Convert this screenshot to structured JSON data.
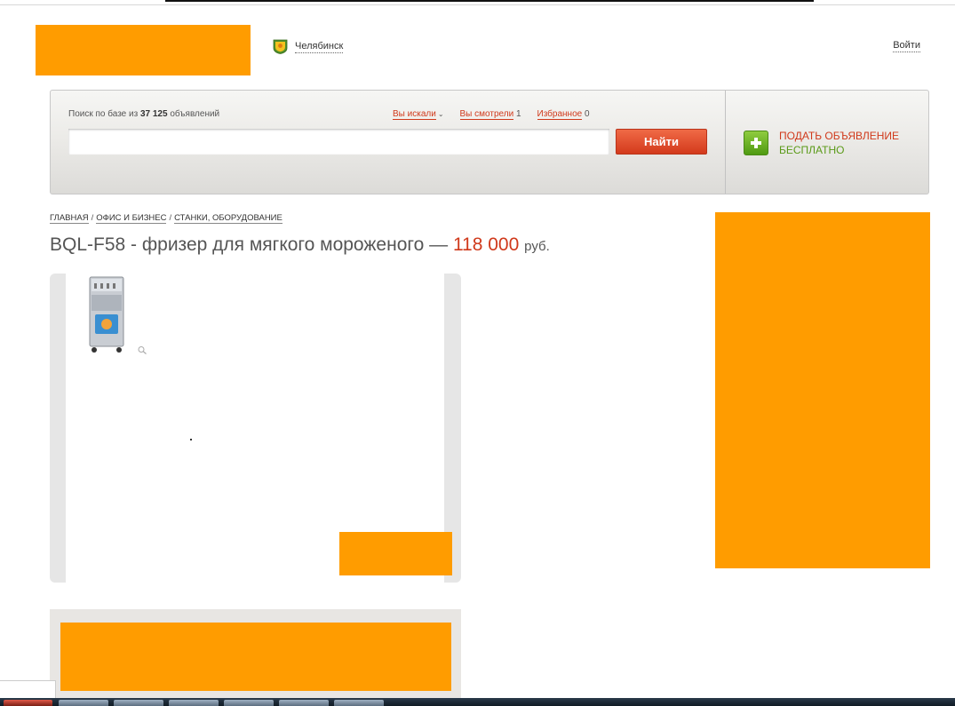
{
  "header": {
    "city": "Челябинск",
    "login": "Войти"
  },
  "search": {
    "caption_prefix": "Поиск по базе из",
    "caption_count": "37 125",
    "caption_suffix": "объявлений",
    "tabs": [
      {
        "label": "Вы искали",
        "count": ""
      },
      {
        "label": "Вы смотрели",
        "count": "1"
      },
      {
        "label": "Избранное",
        "count": "0"
      }
    ],
    "input_value": "",
    "button_label": "Найти"
  },
  "post_ad": {
    "line1": "ПОДАТЬ ОБЪЯВЛЕНИЕ",
    "line2": "БЕСПЛАТНО"
  },
  "breadcrumb": {
    "items": [
      "ГЛАВНАЯ",
      "ОФИС И БИЗНЕС",
      "СТАНКИ, ОБОРУДОВАНИЕ"
    ],
    "separator": "/"
  },
  "listing": {
    "title": "BQL-F58 - фризер для мягкого мороженого —",
    "price": "118 000",
    "currency": "руб."
  },
  "colors": {
    "placeholder_orange": "#ff9c00",
    "accent_red": "#d0391b",
    "accent_green": "#5a9a18"
  },
  "icons": {
    "city": "coat-of-arms-icon",
    "post": "plus-icon",
    "zoom": "zoom-icon",
    "chevron": "chevron-down-icon"
  }
}
